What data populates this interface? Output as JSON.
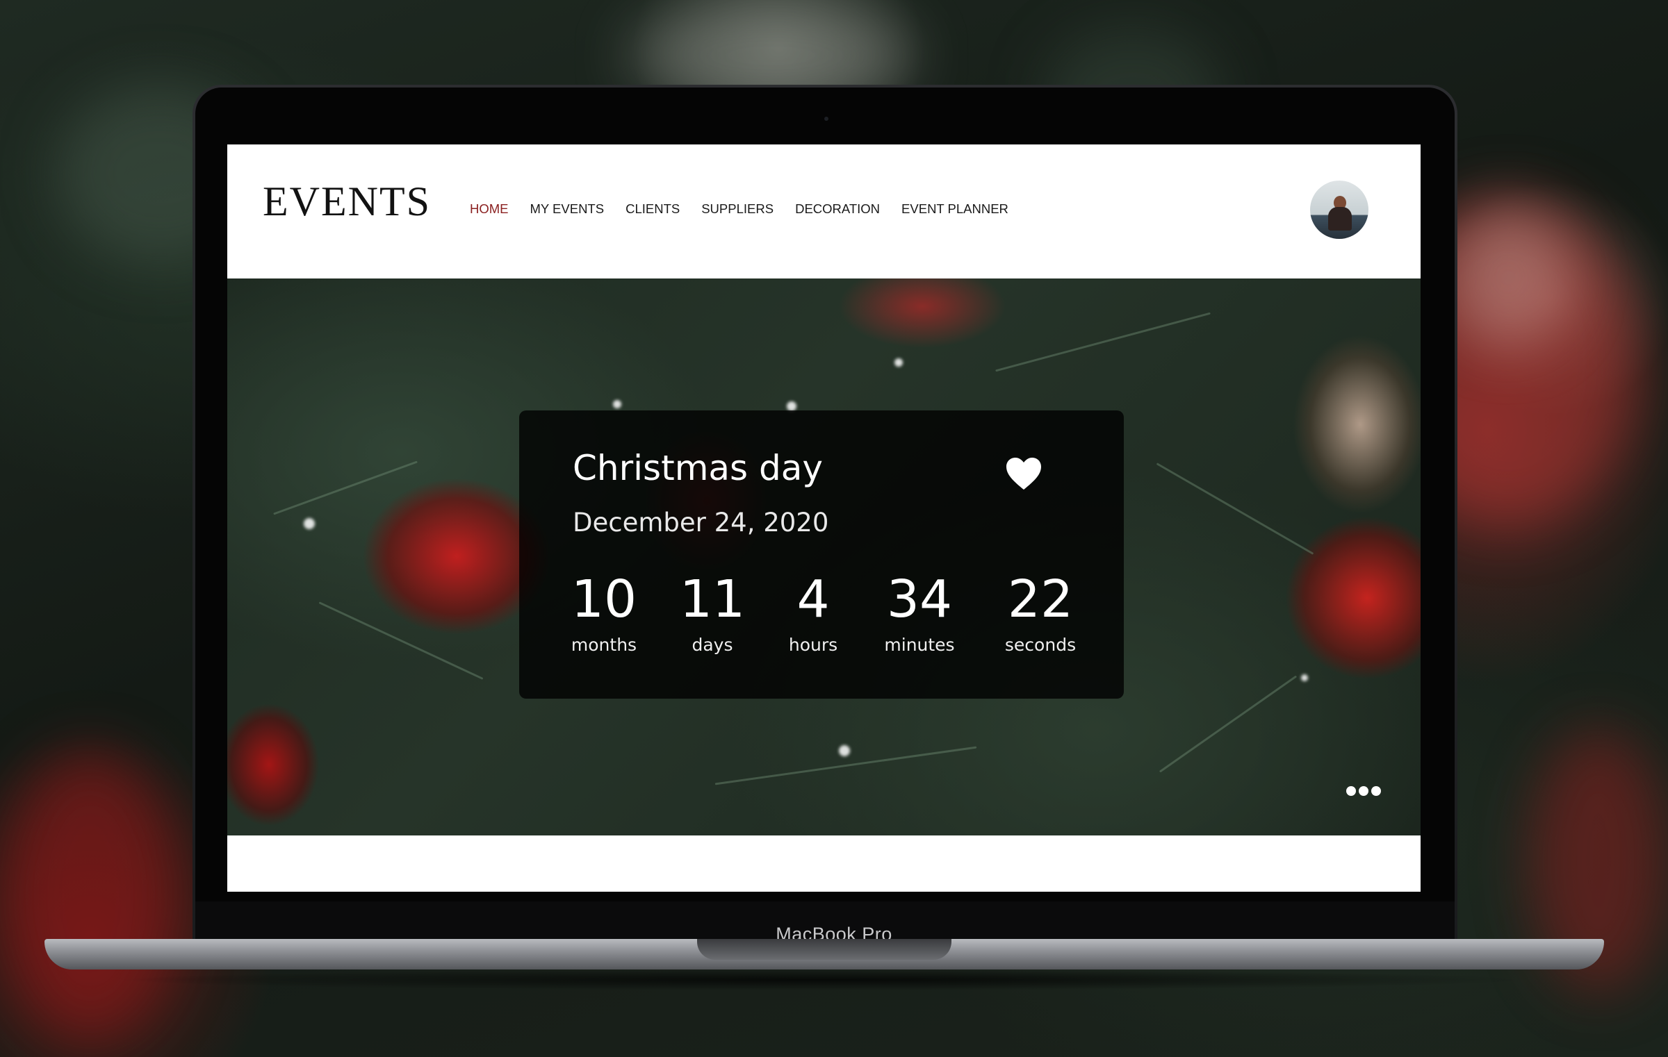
{
  "device": {
    "brand_label": "MacBook Pro"
  },
  "app": {
    "logo": "EVENTS"
  },
  "nav": {
    "items": [
      {
        "label": "HOME",
        "active": true
      },
      {
        "label": "MY EVENTS",
        "active": false
      },
      {
        "label": "CLIENTS",
        "active": false
      },
      {
        "label": "SUPPLIERS",
        "active": false
      },
      {
        "label": "DECORATION",
        "active": false
      },
      {
        "label": "EVENT PLANNER",
        "active": false
      }
    ],
    "active_color": "#8a1f1f"
  },
  "user": {
    "avatar_icon": "user-photo-avatar"
  },
  "countdown": {
    "title": "Christmas day",
    "date": "December 24, 2020",
    "favorite_icon": "heart-icon",
    "units": [
      {
        "value": "10",
        "label": "months"
      },
      {
        "value": "11",
        "label": "days"
      },
      {
        "value": "4",
        "label": "hours"
      },
      {
        "value": "34",
        "label": "minutes"
      },
      {
        "value": "22",
        "label": "seconds"
      }
    ]
  },
  "hero": {
    "more_icon": "more-dots-icon"
  }
}
